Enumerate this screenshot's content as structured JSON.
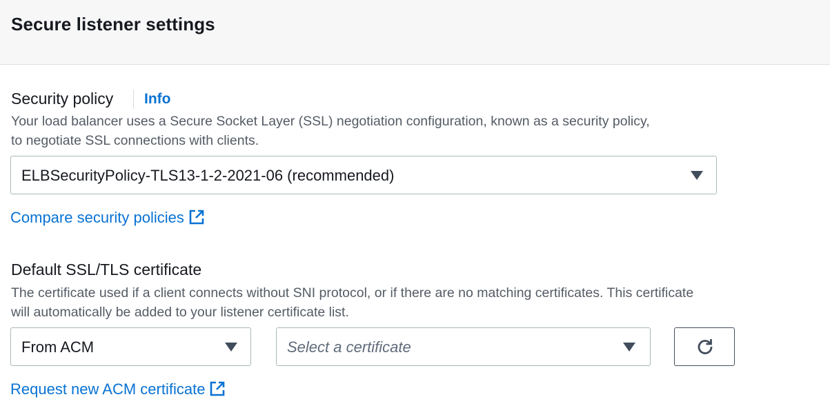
{
  "header": {
    "title": "Secure listener settings"
  },
  "security_policy": {
    "label": "Security policy",
    "info_link": "Info",
    "description_line1": "Your load balancer uses a Secure Socket Layer (SSL) negotiation configuration, known as a security policy,",
    "description_line2": "to negotiate SSL connections with clients.",
    "selected_value": "ELBSecurityPolicy-TLS13-1-2-2021-06 (recommended)",
    "compare_link": "Compare security policies"
  },
  "certificate": {
    "label": "Default SSL/TLS certificate",
    "description_line1": "The certificate used if a client connects without SNI protocol, or if there are no matching certificates. This certificate",
    "description_line2": "will automatically be added to your listener certificate list.",
    "source_value": "From ACM",
    "certificate_placeholder": "Select a certificate",
    "request_link": "Request new ACM certificate"
  },
  "icons": {
    "caret": "caret-down-icon",
    "external": "external-link-icon",
    "refresh": "refresh-icon"
  },
  "colors": {
    "link": "#0972d3",
    "header_bg": "#f7f7f7",
    "border": "#aab7b8",
    "text": "#16191f"
  }
}
